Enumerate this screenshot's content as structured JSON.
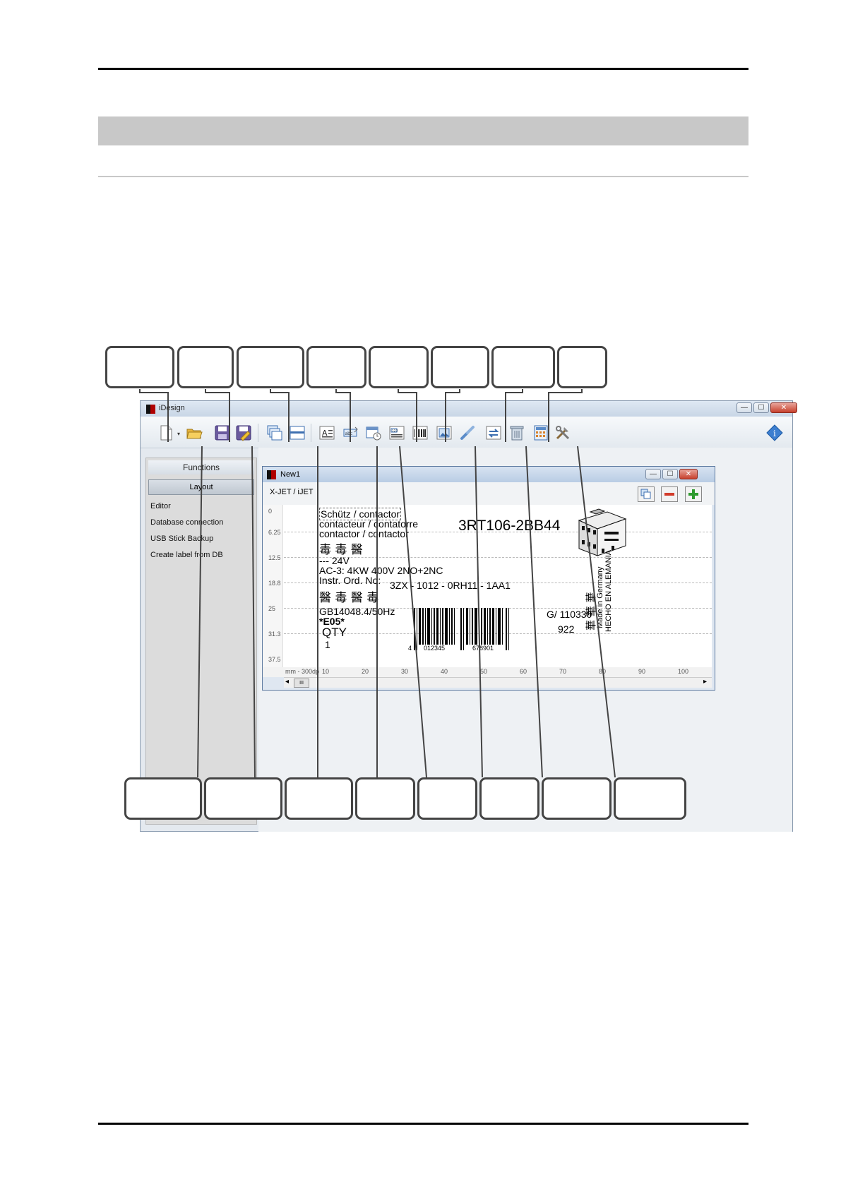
{
  "window": {
    "title": "iDesign",
    "min_label": "—",
    "max_label": "☐",
    "close_label": "✕"
  },
  "toolbar": {
    "icons": [
      "new-file-icon",
      "open-folder-icon",
      "save-icon",
      "save-as-icon",
      "copy-layers-icon",
      "align-icon",
      "text-icon",
      "text-field-icon",
      "date-time-icon",
      "counter-icon",
      "barcode-icon",
      "image-icon",
      "link-icon",
      "refresh-icon",
      "delete-icon",
      "calculator-icon",
      "tools-icon",
      "info-icon"
    ]
  },
  "sidebar": {
    "header": "Functions",
    "tab": "Layout",
    "items": [
      "Editor",
      "Database connection",
      "USB Stick Backup",
      "Create label from DB"
    ]
  },
  "document": {
    "title": "New1",
    "subtitle": "X-JET / iJET",
    "ruler_left": [
      "0",
      "6.25",
      "12.5",
      "18.8",
      "25",
      "31.3",
      "37.5"
    ],
    "ruler_bottom_unit": "mm - 300dp",
    "ruler_bottom": [
      "10",
      "20",
      "30",
      "40",
      "50",
      "60",
      "70",
      "80",
      "90",
      "100"
    ],
    "scroll_thumb": "III"
  },
  "label": {
    "line1": "Schütz / contactor",
    "line2": "contacteur / contatorre",
    "line3": "contactor / contactor",
    "cjk1": "毒 毒 醫",
    "part_no": "3RT106-2BB44",
    "voltage": "--- 24V",
    "ac_rating": "AC-3: 4KW 400V 2NO+2NC",
    "instr": "Instr. Ord. No:",
    "order_no": "3ZX - 1012 - 0RH11 - 1AA1",
    "cjk2": "醫 毒 醫 毒",
    "standard": "GB14048.4/50Hz",
    "e05": "*E05*",
    "qty_label": "QTY",
    "qty": "1",
    "g_code": "G/   110330",
    "num_922": "922",
    "barcode_first": "4",
    "barcode_mid": "012345",
    "barcode_last": "678901",
    "made_in_1": "Made in Germany",
    "made_in_2": "HECHO EN ALEMANIA",
    "cjk3": "華 華 華"
  }
}
